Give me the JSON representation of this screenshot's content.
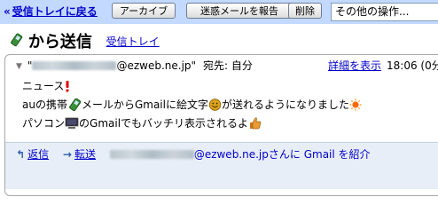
{
  "toolbar": {
    "back_label": "受信トレイに戻る",
    "archive_label": "アーカイブ",
    "spam_label": "迷惑メールを報告",
    "delete_label": "削除",
    "more_actions_value": "その他の操作..."
  },
  "subject": {
    "text": "から送信",
    "label_link": "受信トレイ"
  },
  "message": {
    "sender_domain": "@ezweb.ne.jp\"",
    "recipient_label": "宛先: 自分",
    "details_link": "詳細を表示",
    "time": "18:06 (0分",
    "body": {
      "line1": "ニュース",
      "line2a": "auの携帯",
      "line2b": "メールからGmailに絵文字",
      "line2c": "が送れるようになりました",
      "line3a": "パソコン",
      "line3b": "のGmailでもバッチリ表示されるよ"
    }
  },
  "footer": {
    "reply_label": "返信",
    "forward_label": "転送",
    "intro_domain": "@ezweb.ne.jp",
    "intro_suffix": "さんに Gmail を紹介"
  },
  "icons": {
    "phone": "mobile-phone-icon",
    "exclamation": "exclamation-icon",
    "smile": "smile-face-icon",
    "sun": "sun-icon",
    "pc": "pc-icon",
    "thumbs_up": "thumbs-up-icon",
    "reply": "reply-arrow-icon",
    "forward": "forward-arrow-icon"
  }
}
